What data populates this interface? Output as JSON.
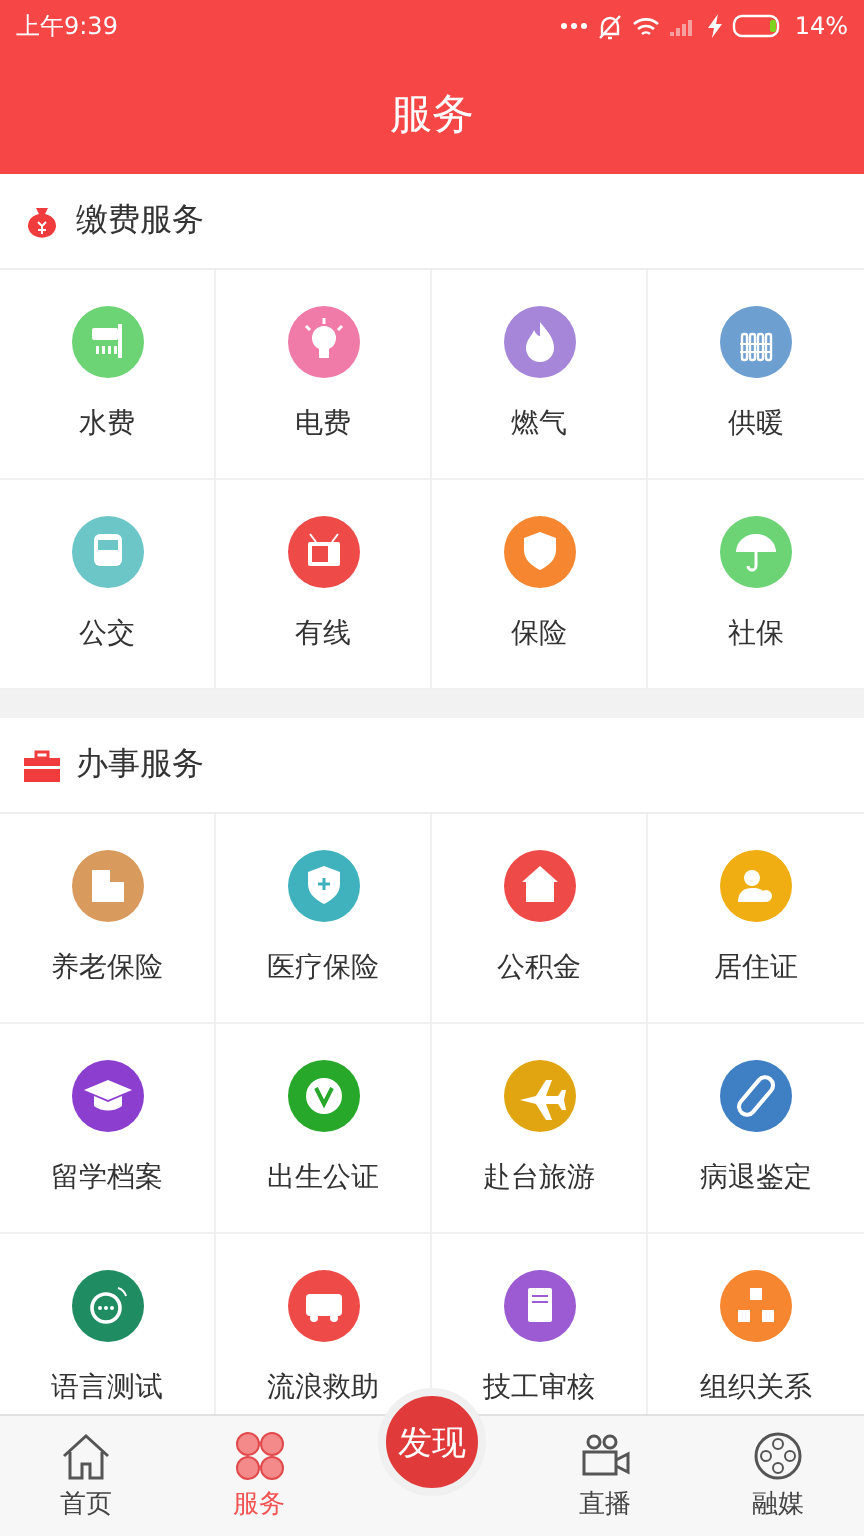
{
  "status_bar": {
    "time": "上午9:39",
    "battery": "14%"
  },
  "header": {
    "title": "服务"
  },
  "sections": [
    {
      "title": "缴费服务",
      "items": [
        {
          "label": "水费",
          "color": "#6cd474"
        },
        {
          "label": "电费",
          "color": "#f07aa8"
        },
        {
          "label": "燃气",
          "color": "#a586d8"
        },
        {
          "label": "供暖",
          "color": "#6d9fd0"
        },
        {
          "label": "公交",
          "color": "#6cc6c8"
        },
        {
          "label": "有线",
          "color": "#ee4b48"
        },
        {
          "label": "保险",
          "color": "#f6862f"
        },
        {
          "label": "社保",
          "color": "#6cd474"
        }
      ]
    },
    {
      "title": "办事服务",
      "items": [
        {
          "label": "养老保险",
          "color": "#d99a5e"
        },
        {
          "label": "医疗保险",
          "color": "#3fb2bd"
        },
        {
          "label": "公积金",
          "color": "#ee4b48"
        },
        {
          "label": "居住证",
          "color": "#f0ae12"
        },
        {
          "label": "留学档案",
          "color": "#8c3fcf"
        },
        {
          "label": "出生公证",
          "color": "#27a82a"
        },
        {
          "label": "赴台旅游",
          "color": "#e2a512"
        },
        {
          "label": "病退鉴定",
          "color": "#3f7fc4"
        },
        {
          "label": "语言测试",
          "color": "#1f8c62"
        },
        {
          "label": "流浪救助",
          "color": "#ee4b48"
        },
        {
          "label": "技工审核",
          "color": "#9c5bd2"
        },
        {
          "label": "组织关系",
          "color": "#f6862f"
        }
      ]
    }
  ],
  "tab_bar": [
    {
      "label": "首页",
      "kind": "tab",
      "selected": false
    },
    {
      "label": "服务",
      "kind": "tab",
      "selected": true
    },
    {
      "label": "发现",
      "kind": "center",
      "selected": false
    },
    {
      "label": "直播",
      "kind": "tab",
      "selected": false
    },
    {
      "label": "融媒",
      "kind": "tab",
      "selected": false
    }
  ]
}
